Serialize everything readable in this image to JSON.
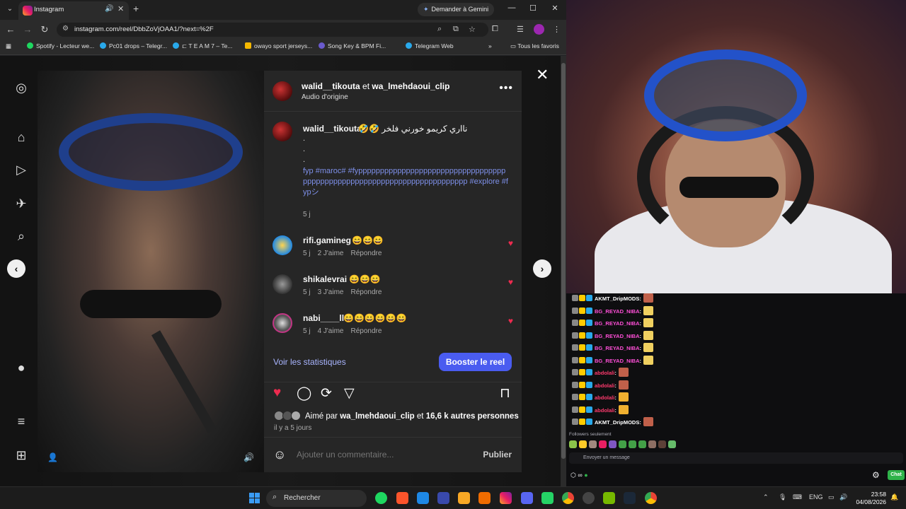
{
  "browser": {
    "tab": {
      "title": "Instagram"
    },
    "gemini_button": "Demander à Gemini",
    "url": "instagram.com/reel/DbbZoVjOAA1/?next=%2F",
    "bookmarks": [
      {
        "label": "Spotify - Lecteur we...",
        "color": "#1ed760"
      },
      {
        "label": "Pc01 drops – Telegr...",
        "color": "#29a9eb"
      },
      {
        "label": "⊏ T E A M 7 – Te...",
        "color": "#29a9eb"
      },
      {
        "label": "owayo sport jerseys...",
        "color": "#f5b800"
      },
      {
        "label": "Song Key & BPM Fi...",
        "color": "#6a5acd"
      },
      {
        "label": "Telegram Web",
        "color": "#29a9eb"
      }
    ],
    "all_favorites": "Tous les favoris"
  },
  "post": {
    "header": {
      "user1": "walid__tikouta",
      "conjunction": "et",
      "user2": "wa_lmehdaoui_clip",
      "audio": "Audio d'origine"
    },
    "caption": {
      "user": "walid__tikouta",
      "text": "🤣🤣 نااري كريمو خورني فلخر",
      "dot": ".",
      "hashtags": "fyp #maroc# #fypppppppppppppppppppppppppppppppppppppppppppppppppppppppppppppppppppppppp #explore #fypシ",
      "time": "5 j"
    },
    "comments": [
      {
        "user": "rifi.gamineg",
        "emojis": "😄😄😄",
        "time": "5 j",
        "likes": "2 J'aime",
        "reply": "Répondre"
      },
      {
        "user": "shikalevrai",
        "emojis": "😄😄😄",
        "time": "5 j",
        "likes": "3 J'aime",
        "reply": "Répondre"
      },
      {
        "user": "nabi____ll",
        "emojis": "😄😄😄😄😄😄",
        "time": "5 j",
        "likes": "4 J'aime",
        "reply": "Répondre"
      }
    ],
    "stats_link": "Voir les statistiques",
    "boost_button": "Booster le reel",
    "liked_by": {
      "prefix": "Aimé par",
      "user": "wa_lmehdaoui_clip",
      "mid": "et",
      "others": "16,6 k autres personnes"
    },
    "post_time": "il y a 5 jours",
    "comment_placeholder": "Ajouter un commentaire...",
    "publish": "Publier"
  },
  "chat": {
    "messages": [
      {
        "user": "AKMT_DripMODS",
        "color": "#ffffff",
        "emote": "#c0604a"
      },
      {
        "user": "BG_REYAD_NIBA",
        "color": "#ff4fd8",
        "emote": "#f0d060"
      },
      {
        "user": "BG_REYAD_NIBA",
        "color": "#ff4fd8",
        "emote": "#f0d060"
      },
      {
        "user": "BG_REYAD_NIBA",
        "color": "#ff4fd8",
        "emote": "#f0d060"
      },
      {
        "user": "BG_REYAD_NIBA",
        "color": "#ff4fd8",
        "emote": "#f0d060"
      },
      {
        "user": "BG_REYAD_NIBA",
        "color": "#ff4fd8",
        "emote": "#f0d060"
      },
      {
        "user": "abdolali",
        "color": "#ff3a6e",
        "emote": "#c0604a"
      },
      {
        "user": "abdolali",
        "color": "#ff3a6e",
        "emote": "#c0604a"
      },
      {
        "user": "abdolali",
        "color": "#ff3a6e",
        "emote": "#f0b030"
      },
      {
        "user": "abdolali",
        "color": "#ff3a6e",
        "emote": "#f0b030"
      },
      {
        "user": "AKMT_DripMODS",
        "color": "#ffffff",
        "emote": "#c0604a"
      }
    ],
    "followers_only": "Followers seulement",
    "input_placeholder": "Envoyer un message",
    "chat_button": "Chat",
    "colon": ":"
  },
  "taskbar": {
    "search": "Rechercher",
    "lang": "ENG",
    "time": "23:58",
    "date": "04/08/2026"
  }
}
